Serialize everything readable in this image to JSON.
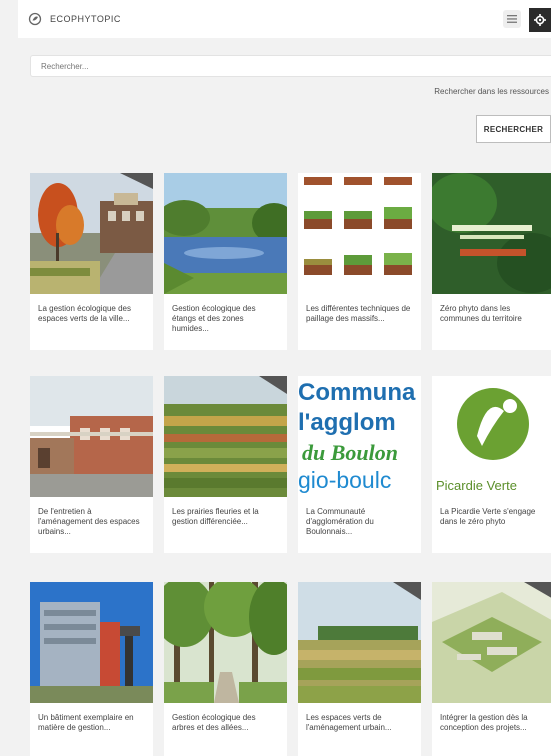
{
  "header": {
    "brand": "ECOPHYTOPIC",
    "logo_icon": "leaf-logo-icon",
    "menu_icon": "hamburger-menu-icon",
    "settings_icon": "gear-icon"
  },
  "search": {
    "placeholder": "Rechercher..."
  },
  "hint": "Rechercher dans les ressources",
  "search_button": "RECHERCHER",
  "graphic_texts": {
    "card7_line1": "Communa",
    "card7_line2": "l'agglom",
    "card7_line3": "du Boulon",
    "card7_line4": "gio-boulc",
    "card8_caption": "Picardie Verte"
  },
  "cards": [
    {
      "text": "La gestion écologique des espaces verts de la ville..."
    },
    {
      "text": "Gestion écologique des étangs et des zones humides..."
    },
    {
      "text": "Les différentes techniques de paillage des massifs..."
    },
    {
      "text": "Zéro phyto dans les communes du territoire"
    },
    {
      "text": "De l'entretien à l'aménagement des espaces urbains..."
    },
    {
      "text": "Les prairies fleuries et la gestion différenciée..."
    },
    {
      "text": "La Communauté d'agglomération du Boulonnais..."
    },
    {
      "text": "La Picardie Verte s'engage dans le zéro phyto"
    },
    {
      "text": "Un bâtiment exemplaire en matière de gestion..."
    },
    {
      "text": "Gestion écologique des arbres et des allées..."
    },
    {
      "text": "Les espaces verts de l'aménagement urbain..."
    },
    {
      "text": "Intégrer la gestion dès la conception des projets..."
    }
  ]
}
